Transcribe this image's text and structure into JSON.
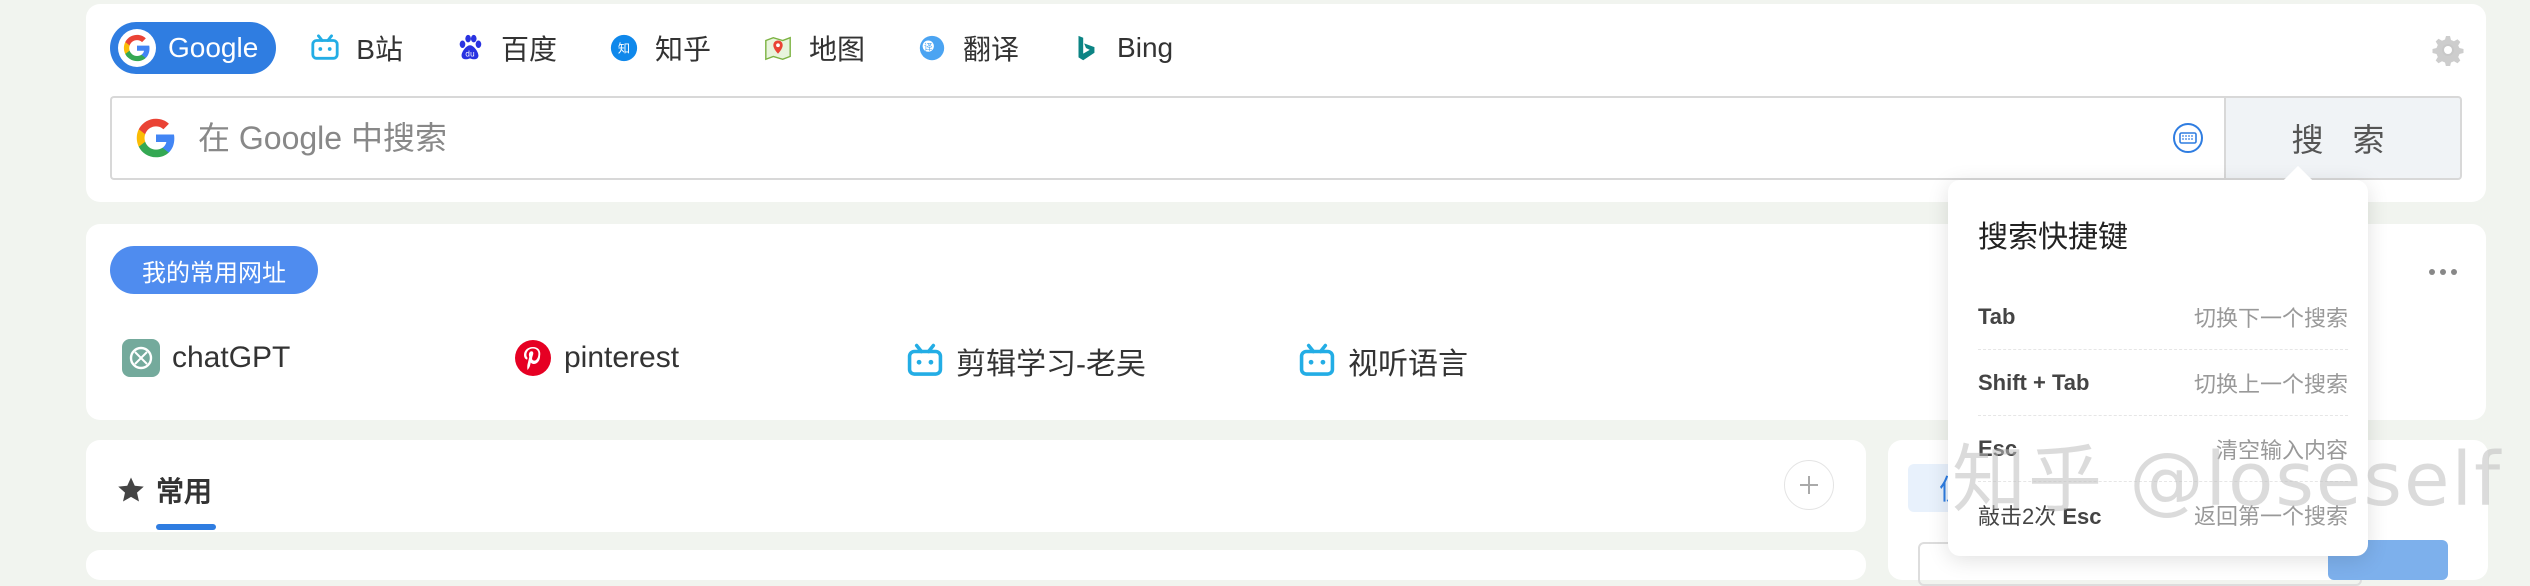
{
  "search": {
    "engines": [
      {
        "label": "Google",
        "icon": "google-icon",
        "active": true
      },
      {
        "label": "B站",
        "icon": "bilibili-icon"
      },
      {
        "label": "百度",
        "icon": "baidu-icon"
      },
      {
        "label": "知乎",
        "icon": "zhihu-icon"
      },
      {
        "label": "地图",
        "icon": "map-icon"
      },
      {
        "label": "翻译",
        "icon": "translate-icon"
      },
      {
        "label": "Bing",
        "icon": "bing-icon"
      }
    ],
    "placeholder": "在 Google 中搜索",
    "value": "",
    "button_label": "搜 索"
  },
  "favorites": {
    "tag": "我的常用网址",
    "items": [
      {
        "label": "chatGPT",
        "icon": "openai-icon"
      },
      {
        "label": "pinterest",
        "icon": "pinterest-icon"
      },
      {
        "label": "剪辑学习-老吴",
        "icon": "bilibili-icon"
      },
      {
        "label": "视听语言",
        "icon": "bilibili-icon"
      }
    ]
  },
  "common": {
    "title": "常用",
    "side_tab": "便"
  },
  "shortcuts": {
    "title": "搜索快捷键",
    "rows": [
      {
        "key_prefix": "",
        "key": "Tab",
        "desc": "切换下一个搜索"
      },
      {
        "key_prefix": "",
        "key": "Shift + Tab",
        "desc": "切换上一个搜索"
      },
      {
        "key_prefix": "",
        "key": "Esc",
        "desc": "清空输入内容"
      },
      {
        "key_prefix": "敲击2次 ",
        "key": "Esc",
        "desc": "返回第一个搜索"
      }
    ]
  },
  "watermark": "知乎 @loseself",
  "colors": {
    "accent": "#2f7de1",
    "tag": "#4f8cef",
    "background": "#f1f4ef"
  }
}
